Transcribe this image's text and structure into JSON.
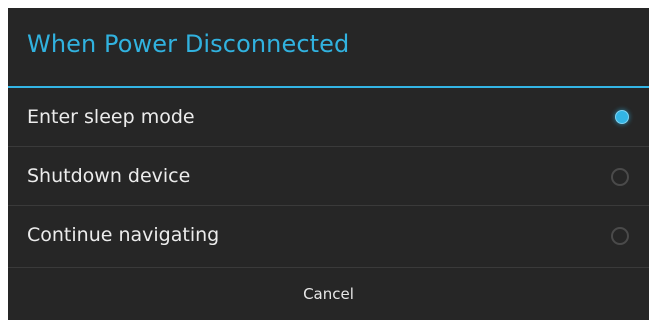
{
  "dialog": {
    "title": "When Power Disconnected",
    "options": [
      {
        "label": "Enter sleep mode",
        "selected": true
      },
      {
        "label": "Shutdown device",
        "selected": false
      },
      {
        "label": "Continue navigating",
        "selected": false
      }
    ],
    "cancel_label": "Cancel"
  },
  "colors": {
    "accent": "#33b5e5",
    "title": "#31b2df",
    "background": "#262626",
    "text": "#ececec"
  }
}
